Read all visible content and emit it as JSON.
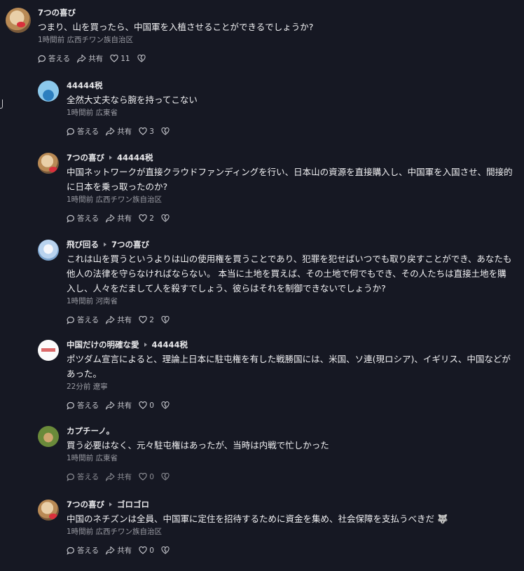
{
  "actions": {
    "reply_label": "答える",
    "share_label": "共有"
  },
  "comments": [
    {
      "author": "7つの喜び",
      "reply_to": "",
      "text": "つまり、山を買ったら、中国軍を入植させることができるでしょうか?",
      "time": "1時間前",
      "location": "広西チワン族自治区",
      "likes": "11",
      "avatar_icon": "cat-avatar"
    },
    {
      "author": "44444税",
      "reply_to": "",
      "text": "全然大丈夫なら腕を持ってこない",
      "time": "1時間前",
      "location": "広東省",
      "likes": "3",
      "avatar_icon": "wave-avatar"
    },
    {
      "author": "7つの喜び",
      "reply_to": "44444税",
      "text": "中国ネットワークが直接クラウドファンディングを行い、日本山の資源を直接購入し、中国軍を入国させ、間接的に日本を乗っ取ったのか?",
      "time": "1時間前",
      "location": "広西チワン族自治区",
      "likes": "2",
      "avatar_icon": "cat-avatar"
    },
    {
      "author": "飛び回る",
      "reply_to": "7つの喜び",
      "text": "これは山を買うというよりは山の使用権を買うことであり、犯罪を犯せばいつでも取り戻すことができ、あなたも他人の法律を守らなければならない。 本当に土地を買えば、その土地で何でもでき、その人たちは直接土地を購入し、人々をだまして人を殺すでしょう、彼らはそれを制御できないでしょうか?",
      "time": "1時間前",
      "location": "河南省",
      "likes": "2",
      "avatar_icon": "anime-avatar"
    },
    {
      "author": "中国だけの明確な愛",
      "reply_to": "44444税",
      "text": "ポツダム宣言によると、理論上日本に駐屯権を有した戦勝国には、米国、ソ連(現ロシア)、イギリス、中国などがあった。",
      "time": "22分前",
      "location": "遼寧",
      "likes": "0",
      "avatar_icon": "text-avatar"
    },
    {
      "author": "カプチーノ。",
      "reply_to": "",
      "text": "買う必要はなく、元々駐屯権はあったが、当時は内戦で忙しかった",
      "time": "1時間前",
      "location": "広東省",
      "likes": "0",
      "avatar_icon": "dog-avatar"
    },
    {
      "author": "7つの喜び",
      "reply_to": "ゴロゴロ",
      "text": "中国のネチズンは全員、中国軍に定住を招待するために資金を集め、社会保障を支払うべきだ 🐺",
      "time": "1時間前",
      "location": "広西チワン族自治区",
      "likes": "0",
      "avatar_icon": "cat-avatar"
    }
  ]
}
